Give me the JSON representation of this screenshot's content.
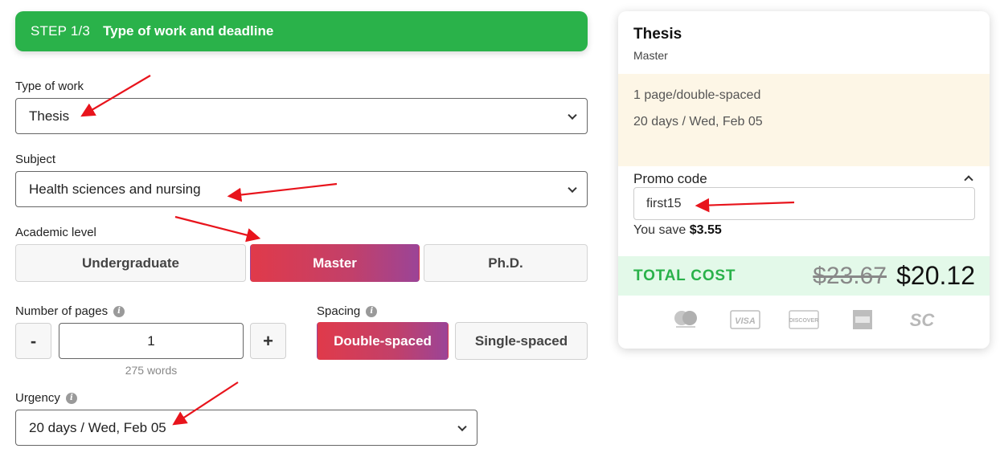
{
  "step": {
    "number": "STEP 1/3",
    "title": "Type of work and deadline"
  },
  "type_of_work": {
    "label": "Type of work",
    "value": "Thesis"
  },
  "subject": {
    "label": "Subject",
    "value": "Health sciences and nursing"
  },
  "academic_level": {
    "label": "Academic level",
    "options": [
      "Undergraduate",
      "Master",
      "Ph.D."
    ],
    "selected": "Master"
  },
  "pages": {
    "label": "Number of pages",
    "minus": "-",
    "value": "1",
    "plus": "+",
    "words": "275 words"
  },
  "spacing": {
    "label": "Spacing",
    "options": [
      "Double-spaced",
      "Single-spaced"
    ],
    "selected": "Double-spaced"
  },
  "urgency": {
    "label": "Urgency",
    "value": "20 days / Wed, Feb 05"
  },
  "summary": {
    "title": "Thesis",
    "level": "Master",
    "pages_line": "1 page/double-spaced",
    "deadline_line": "20 days / Wed, Feb 05",
    "promo_label": "Promo code",
    "promo_value": "first15",
    "save_prefix": "You save",
    "save_amount": "$3.55",
    "total_label": "TOTAL COST",
    "old_price": "$23.67",
    "new_price": "$20.12"
  },
  "payment_icons": [
    "mastercard-icon",
    "visa-icon",
    "discover-icon",
    "amex-icon",
    "sc-icon"
  ],
  "colors": {
    "brand_green": "#2ab24a",
    "gradient_start": "#e03a4a",
    "gradient_end": "#9b4497",
    "summary_bg": "#fdf6e6",
    "total_bg": "#e3f9e9",
    "annotation_arrow": "#e8141c"
  }
}
